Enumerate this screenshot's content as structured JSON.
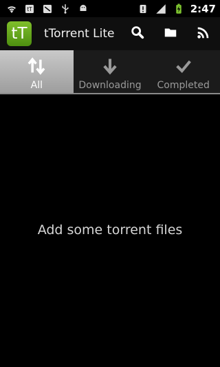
{
  "status_bar": {
    "time": "2:47",
    "icons": [
      "wifi-icon",
      "sim-icon",
      "notification-icon",
      "usb-icon",
      "android-debug-icon",
      "alert-icon",
      "signal-icon",
      "battery-charging-icon"
    ]
  },
  "action_bar": {
    "logo_text": "tT",
    "title": "tTorrent Lite",
    "actions": [
      "search-icon",
      "folder-icon",
      "rss-icon"
    ]
  },
  "tabs": [
    {
      "label": "All",
      "icon": "up-down-arrows-icon",
      "active": true
    },
    {
      "label": "Downloading",
      "icon": "down-arrow-icon",
      "active": false
    },
    {
      "label": "Completed",
      "icon": "checkmark-icon",
      "active": false
    }
  ],
  "main": {
    "empty_message": "Add some torrent files"
  },
  "colors": {
    "logo_green": "#6aa81f",
    "active_tab": "#b8b8b8",
    "background": "#000000"
  }
}
